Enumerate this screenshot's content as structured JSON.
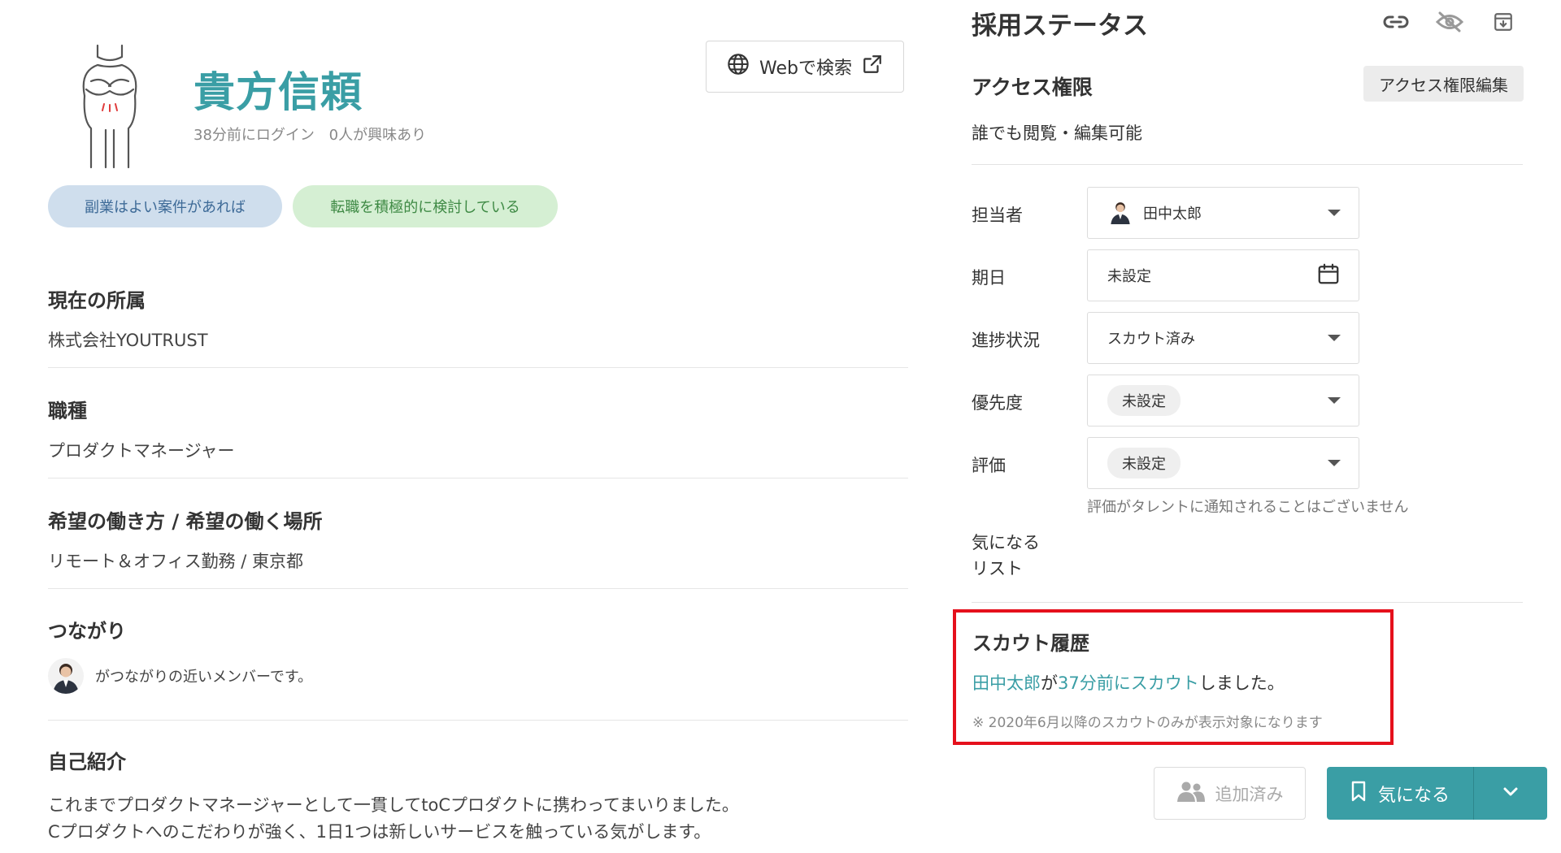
{
  "profile": {
    "name": "貴方信頼",
    "last_login": "38分前にログイン",
    "interest": "0人が興味あり",
    "tags": [
      "副業はよい案件があれば",
      "転職を積極的に検討している"
    ],
    "web_search_label": "Webで検索"
  },
  "sections": {
    "affiliation": {
      "title": "現在の所属",
      "value": "株式会社YOUTRUST"
    },
    "job_type": {
      "title": "職種",
      "value": "プロダクトマネージャー"
    },
    "work_style": {
      "title": "希望の働き方 / 希望の働く場所",
      "value": "リモート＆オフィス勤務 / 東京都"
    },
    "connections": {
      "title": "つながり",
      "text": "がつながりの近いメンバーです。"
    },
    "intro": {
      "title": "自己紹介",
      "line1": "これまでプロダクトマネージャーとして一貫してtoCプロダクトに携わってまいりました。",
      "line2": "Cプロダクトへのこだわりが強く、1日1つは新しいサービスを触っている気がします。"
    }
  },
  "status": {
    "title": "採用ステータス",
    "icons": [
      "link-icon",
      "eye-off-icon",
      "archive-icon"
    ],
    "access": {
      "title": "アクセス権限",
      "edit_label": "アクセス権限編集",
      "value": "誰でも閲覧・編集可能"
    },
    "fields": {
      "assignee": {
        "label": "担当者",
        "value": "田中太郎"
      },
      "due_date": {
        "label": "期日",
        "value": "未設定"
      },
      "progress": {
        "label": "進捗状況",
        "value": "スカウト済み"
      },
      "priority": {
        "label": "優先度",
        "value": "未設定"
      },
      "rating": {
        "label": "評価",
        "value": "未設定"
      }
    },
    "rating_note": "評価がタレントに通知されることはございません",
    "watch_list_label_1": "気になる",
    "watch_list_label_2": "リスト"
  },
  "scout_history": {
    "title": "スカウト履歴",
    "user": "田中太郎",
    "particle": "が",
    "time_link": "37分前にスカウト",
    "suffix": "しました。",
    "note": "※ 2020年6月以降のスカウトのみが表示対象になります"
  },
  "actions": {
    "added_label": "追加済み",
    "watch_label": "気になる"
  },
  "colors": {
    "accent": "#3a9ea5",
    "highlight_border": "#e5101c",
    "tag_blue_bg": "#cfdeed",
    "tag_green_bg": "#d5efd3"
  }
}
